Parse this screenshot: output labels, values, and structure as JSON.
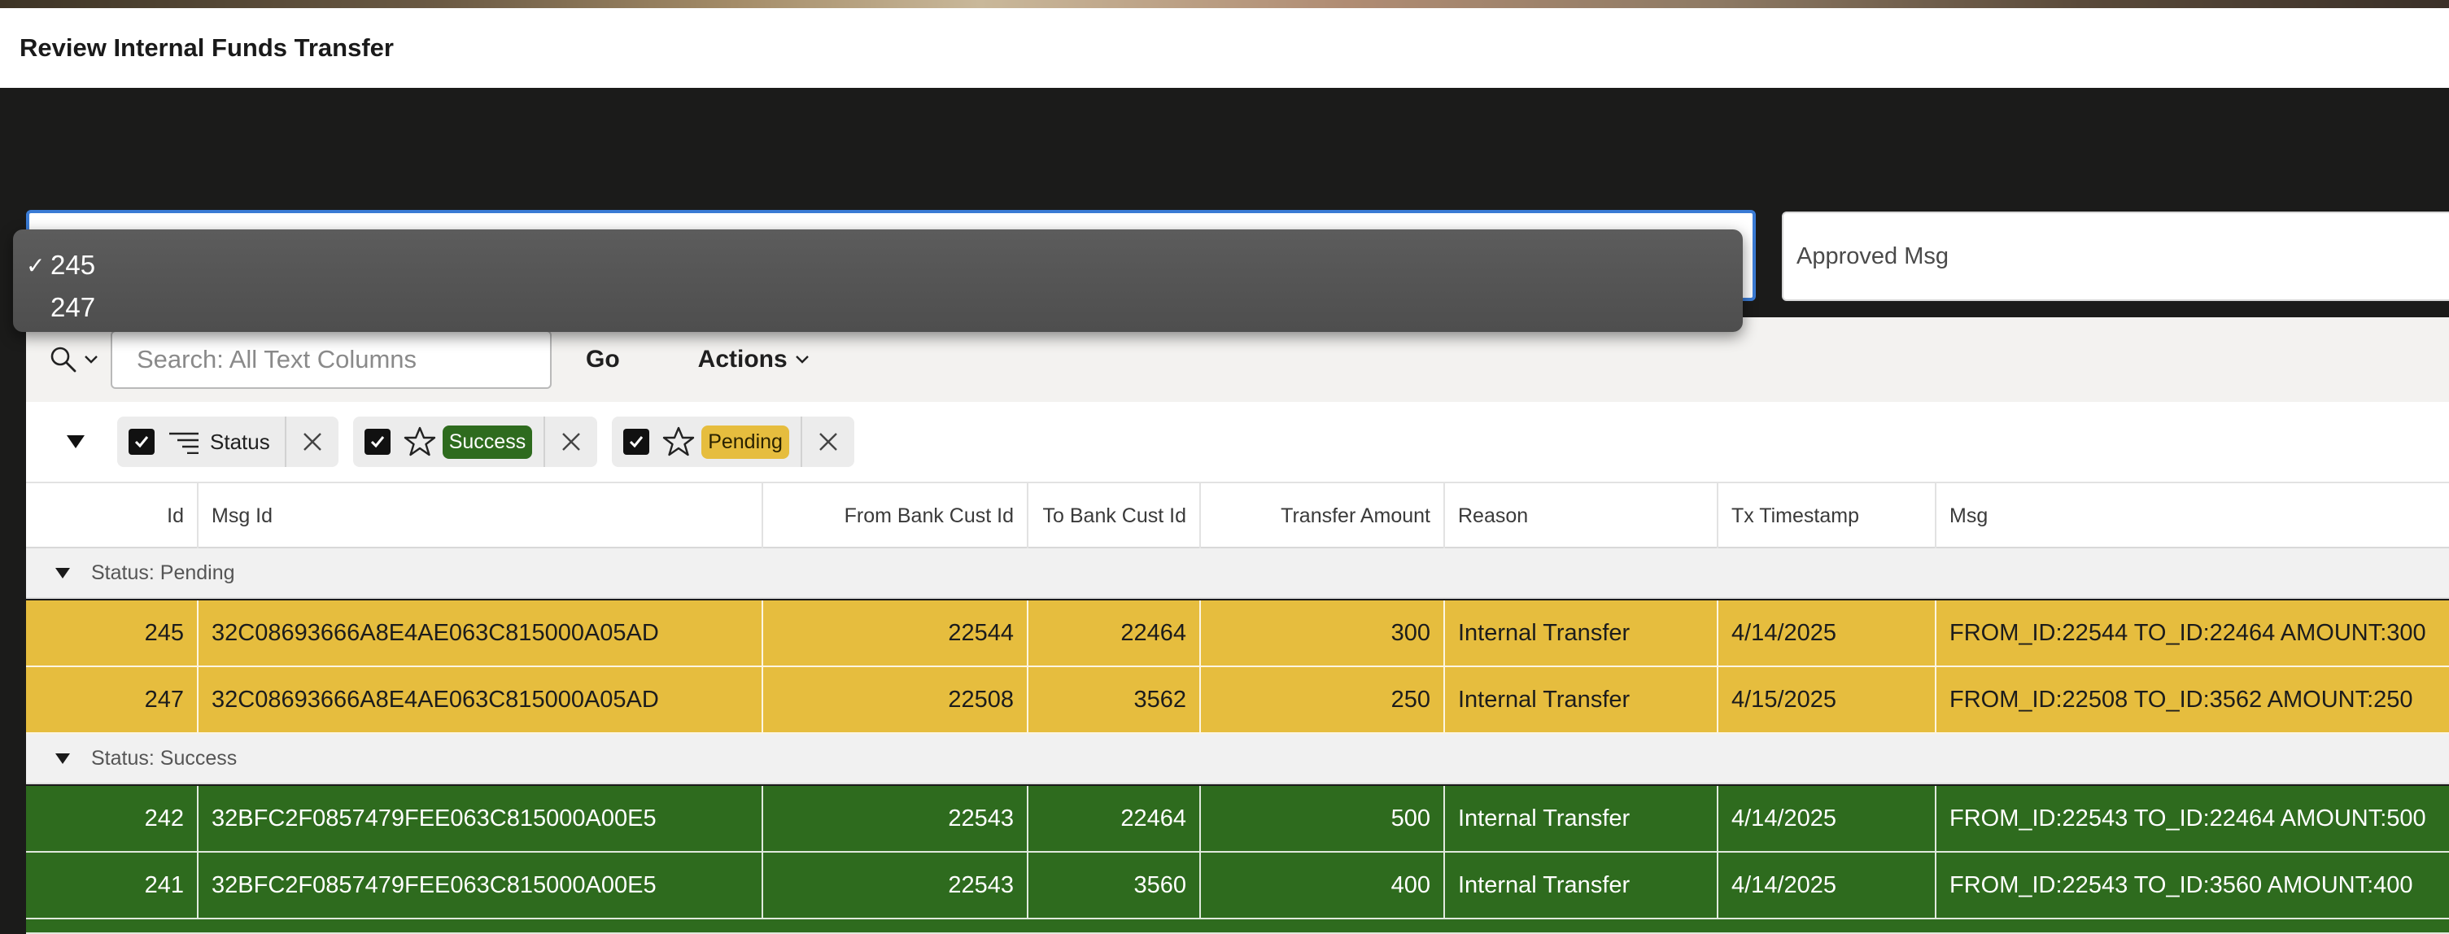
{
  "page": {
    "title": "Review Internal Funds Transfer"
  },
  "dropdown": {
    "options": [
      {
        "label": "245",
        "selected": true,
        "check": "✓"
      },
      {
        "label": "247",
        "selected": false,
        "check": ""
      }
    ]
  },
  "approved_field": {
    "label": "Approved Msg"
  },
  "toolbar": {
    "search_placeholder": "Search: All Text Columns",
    "go_label": "Go",
    "actions_label": "Actions"
  },
  "filters": [
    {
      "type": "control-break",
      "label": "Status"
    },
    {
      "type": "highlight",
      "label": "Success",
      "color": "#2e6b1e"
    },
    {
      "type": "highlight",
      "label": "Pending",
      "color": "#e6bd3e"
    }
  ],
  "columns": [
    "Id",
    "Msg Id",
    "From Bank Cust Id",
    "To Bank Cust Id",
    "Transfer Amount",
    "Reason",
    "Tx Timestamp",
    "Msg"
  ],
  "groups": [
    {
      "label": "Status: Pending",
      "color": "#e6bd3e",
      "rows": [
        {
          "id": "245",
          "msg_id": "32C08693666A8E4AE063C815000A05AD",
          "from": "22544",
          "to": "22464",
          "amount": "300",
          "reason": "Internal Transfer",
          "ts": "4/14/2025",
          "msg": "FROM_ID:22544 TO_ID:22464 AMOUNT:300"
        },
        {
          "id": "247",
          "msg_id": "32C08693666A8E4AE063C815000A05AD",
          "from": "22508",
          "to": "3562",
          "amount": "250",
          "reason": "Internal Transfer",
          "ts": "4/15/2025",
          "msg": "FROM_ID:22508 TO_ID:3562 AMOUNT:250"
        }
      ]
    },
    {
      "label": "Status: Success",
      "color": "#2e6b1e",
      "rows": [
        {
          "id": "242",
          "msg_id": "32BFC2F0857479FEE063C815000A00E5",
          "from": "22543",
          "to": "22464",
          "amount": "500",
          "reason": "Internal Transfer",
          "ts": "4/14/2025",
          "msg": "FROM_ID:22543 TO_ID:22464 AMOUNT:500"
        },
        {
          "id": "241",
          "msg_id": "32BFC2F0857479FEE063C815000A00E5",
          "from": "22543",
          "to": "3560",
          "amount": "400",
          "reason": "Internal Transfer",
          "ts": "4/14/2025",
          "msg": "FROM_ID:22543 TO_ID:3560 AMOUNT:400"
        }
      ]
    }
  ]
}
